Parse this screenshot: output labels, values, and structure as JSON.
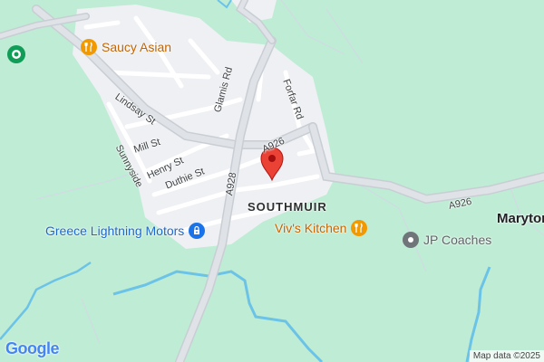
{
  "map": {
    "places": {
      "southmuir": "SOUTHMUIR",
      "maryton": "Maryton"
    },
    "roads": {
      "lindsay_st": "Lindsay St",
      "glamis_rd": "Glamis Rd",
      "forfar_rd": "Forfar Rd",
      "mill_st": "Mill St",
      "henry_st": "Henry St",
      "sunnyside": "Sunnyside",
      "duthie_st": "Duthie St",
      "a926_main": "A926",
      "a926_east": "A926",
      "a928": "A928"
    },
    "pois": [
      {
        "label": "Saucy Asian",
        "icon": "restaurant-icon",
        "color": "#f29900"
      },
      {
        "label": "Greece Lightning Motors",
        "icon": "car-service-icon",
        "color": "#1a73e8"
      },
      {
        "label": "Viv's Kitchen",
        "icon": "restaurant-icon",
        "color": "#f29900"
      },
      {
        "label": "JP Coaches",
        "icon": "location-icon",
        "color": "#70757a"
      }
    ],
    "attribution": "Map data ©2025",
    "logo": "Google",
    "colors": {
      "background": "#bfecd4",
      "urban": "#eef0f3",
      "water": "#6cc3e8",
      "pin": "#ea4335",
      "teal_marker": "#0f9d58"
    }
  }
}
